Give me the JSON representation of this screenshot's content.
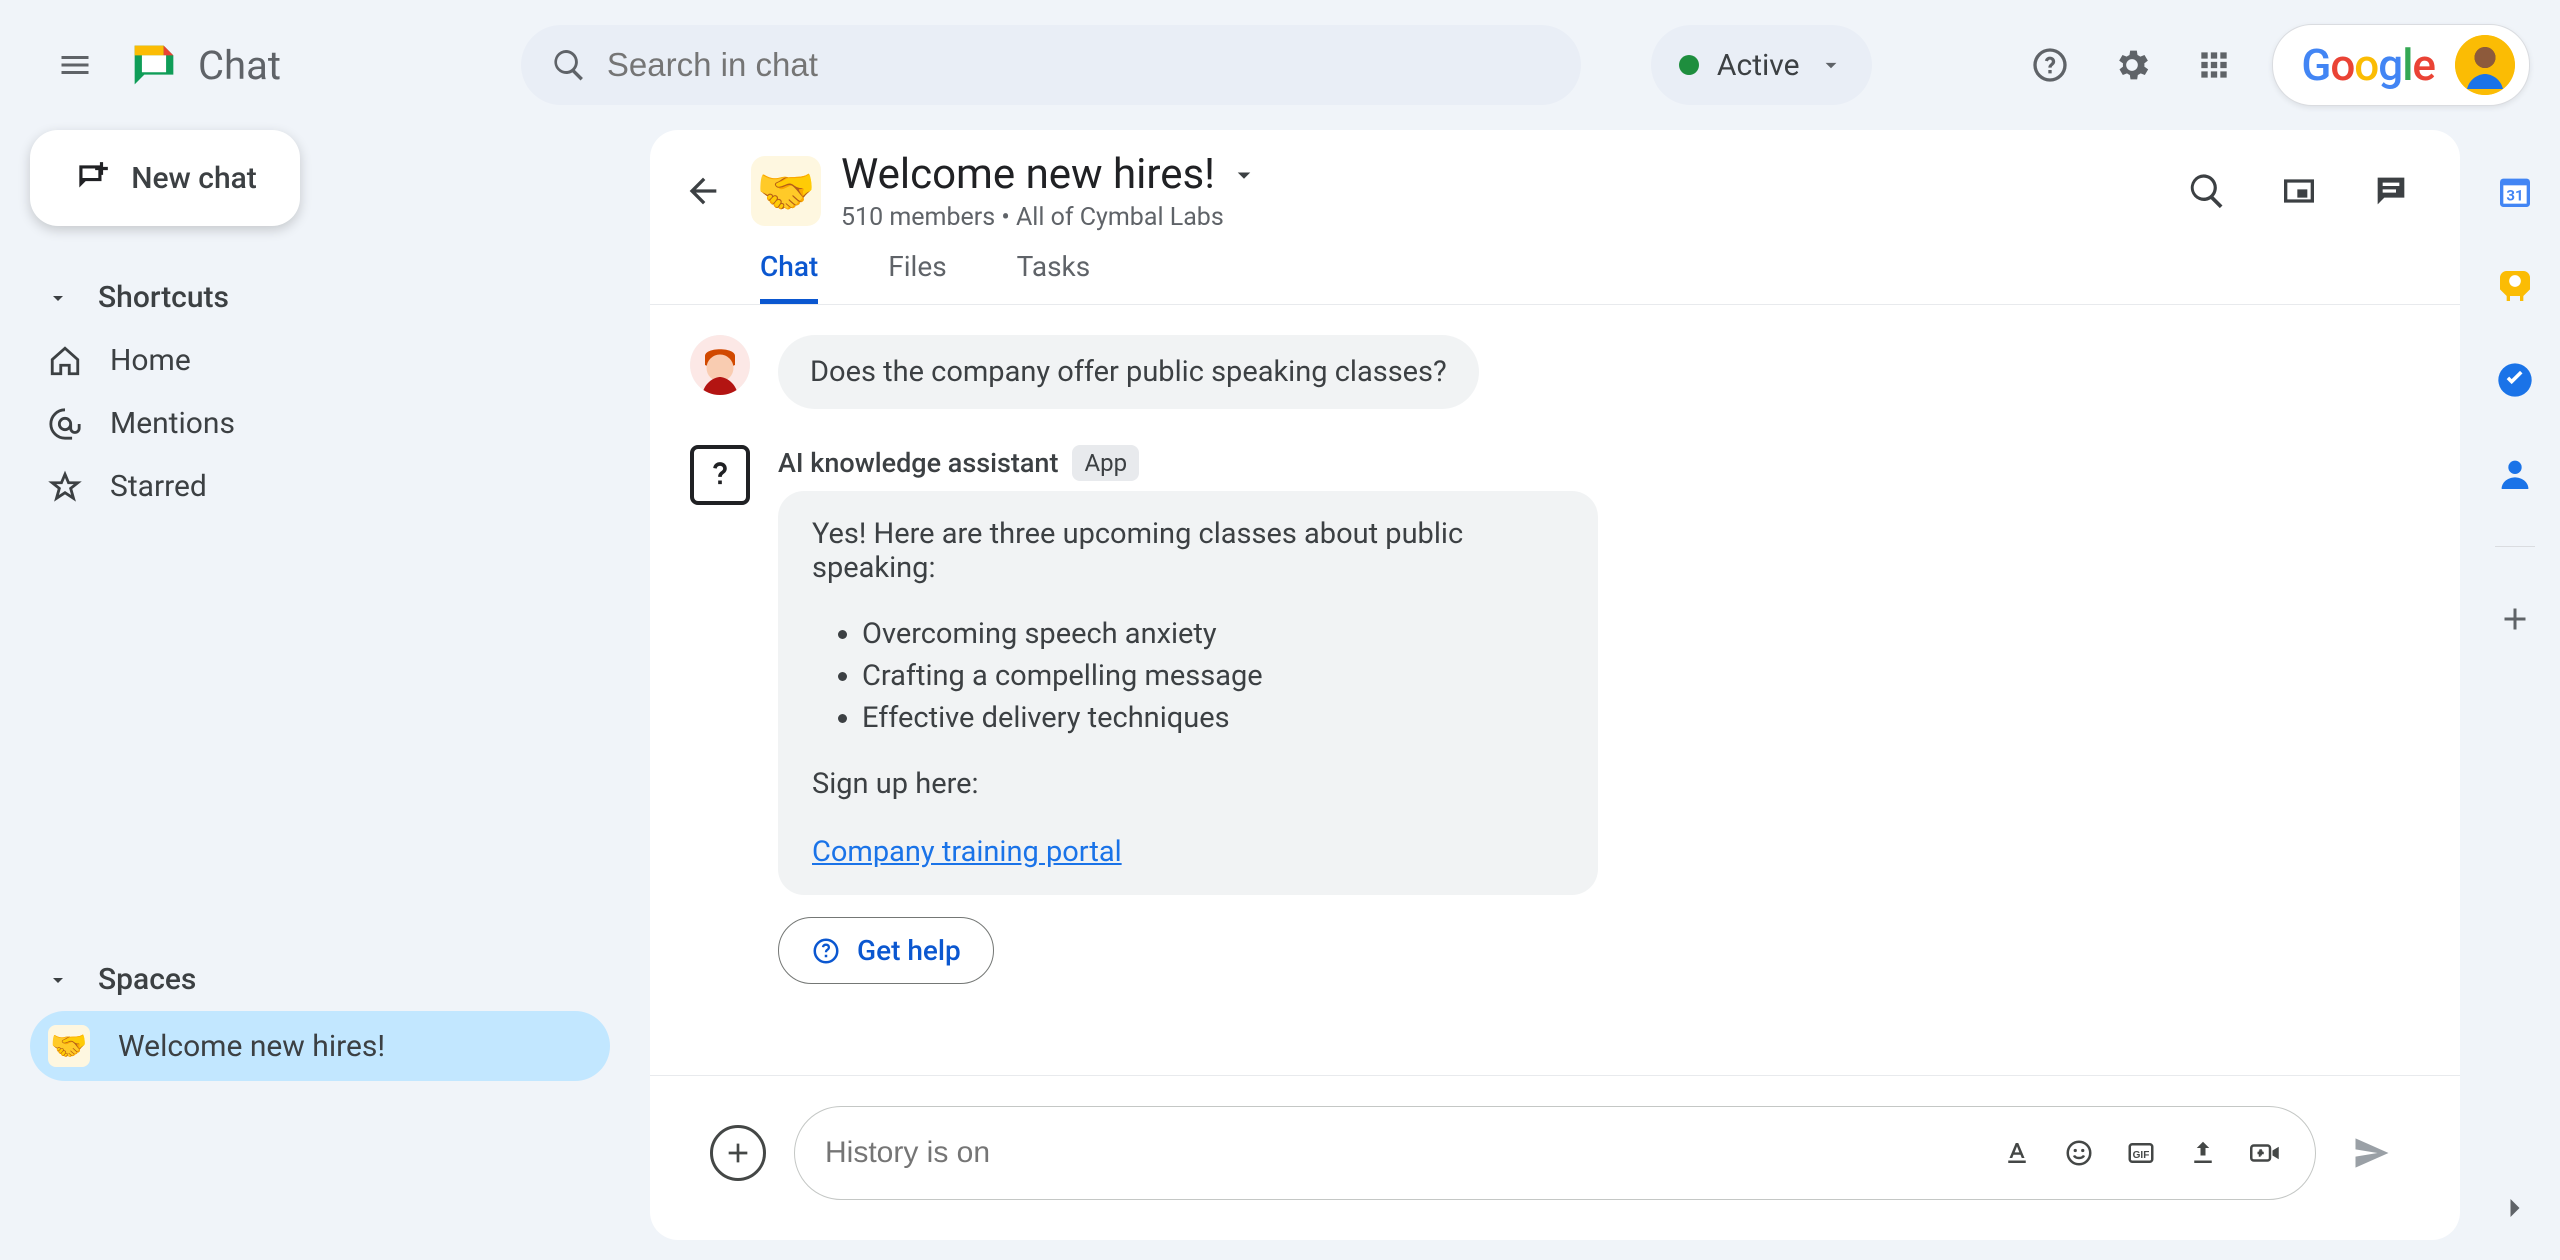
{
  "app": {
    "name": "Chat"
  },
  "search": {
    "placeholder": "Search in chat"
  },
  "status": {
    "label": "Active"
  },
  "google_word": "Google",
  "sidebar": {
    "new_chat": "New chat",
    "shortcuts": {
      "header": "Shortcuts",
      "items": [
        {
          "icon": "home",
          "label": "Home"
        },
        {
          "icon": "mention",
          "label": "Mentions"
        },
        {
          "icon": "star",
          "label": "Starred"
        }
      ]
    },
    "spaces": {
      "header": "Spaces",
      "items": [
        {
          "emoji": "🤝",
          "label": "Welcome new hires!",
          "selected": true
        }
      ]
    }
  },
  "space": {
    "emoji": "🤝",
    "title": "Welcome new hires!",
    "subtitle": "510 members  •  All of Cymbal Labs",
    "tabs": [
      "Chat",
      "Files",
      "Tasks"
    ],
    "active_tab_index": 0
  },
  "messages": {
    "user_question": "Does the company offer public speaking classes?",
    "bot": {
      "sender": "AI knowledge assistant",
      "badge": "App",
      "intro": "Yes! Here are three upcoming classes about public speaking:",
      "bullets": [
        "Overcoming speech anxiety",
        "Crafting a compelling message",
        "Effective delivery techniques"
      ],
      "signup_text": "Sign up here:",
      "link_text": "Company training portal",
      "help_button": "Get help"
    }
  },
  "composer": {
    "placeholder": "History is on"
  }
}
